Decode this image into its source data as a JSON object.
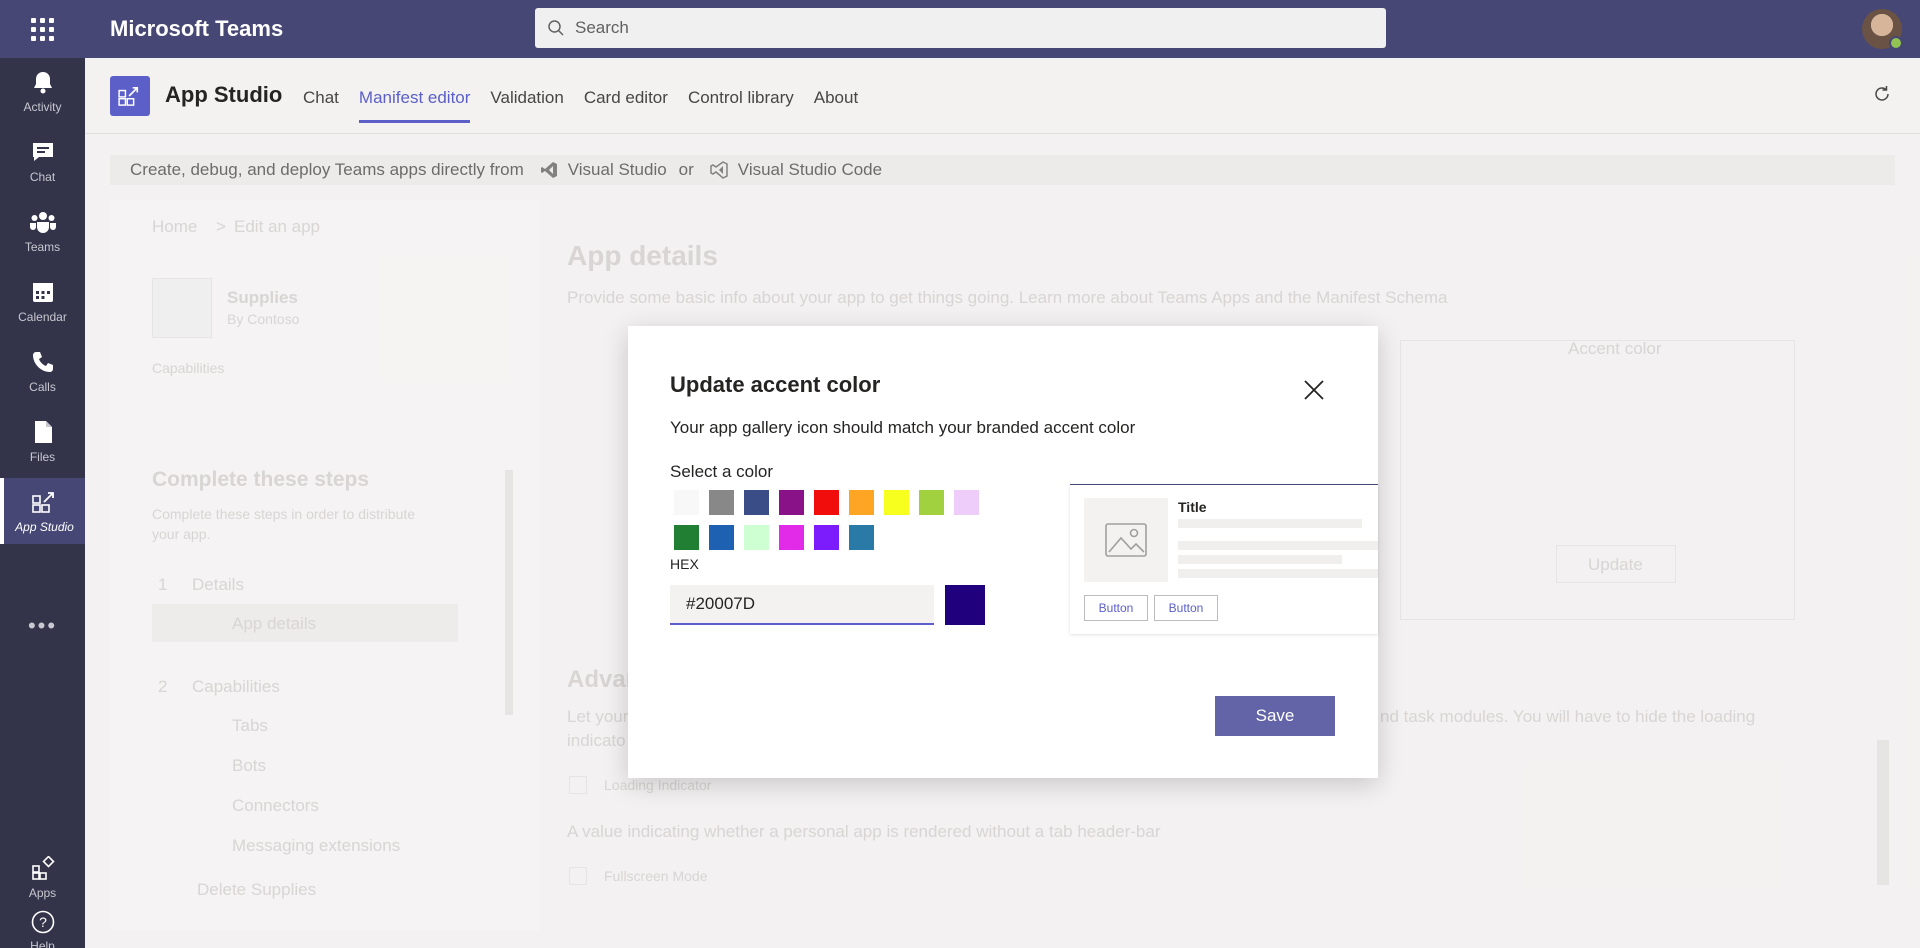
{
  "topbar": {
    "app_name": "Microsoft Teams",
    "search_placeholder": "Search"
  },
  "rail": {
    "items": [
      {
        "label": "Activity",
        "icon": "bell-icon"
      },
      {
        "label": "Chat",
        "icon": "chat-icon"
      },
      {
        "label": "Teams",
        "icon": "teams-icon"
      },
      {
        "label": "Calendar",
        "icon": "calendar-icon"
      },
      {
        "label": "Calls",
        "icon": "phone-icon"
      },
      {
        "label": "Files",
        "icon": "file-icon"
      },
      {
        "label": "App Studio",
        "icon": "app-studio-icon"
      }
    ],
    "more": "•••",
    "bottom": [
      {
        "label": "Apps",
        "icon": "apps-icon"
      },
      {
        "label": "Help",
        "icon": "help-icon"
      }
    ]
  },
  "app_header": {
    "title": "App Studio",
    "tabs": [
      "Chat",
      "Manifest editor",
      "Validation",
      "Card editor",
      "Control library",
      "About"
    ],
    "active_tab": "Manifest editor"
  },
  "banner": {
    "text": "Create, debug, and deploy Teams apps directly from",
    "vs": "Visual Studio",
    "or": "or",
    "vscode": "Visual Studio Code"
  },
  "background": {
    "breadcrumb_home": "Home",
    "breadcrumb_sep": ">",
    "breadcrumb_current": "Edit an app",
    "app_name": "Supplies",
    "app_by": "By Contoso",
    "capabilities": "Capabilities",
    "steps_title": "Complete these steps",
    "steps_desc_1": "Complete these steps in order to distribute",
    "steps_desc_2": "your app.",
    "step1_num": "1",
    "step1": "Details",
    "step1_sub": "App details",
    "step2_num": "2",
    "step2": "Capabilities",
    "step2_items": [
      "Tabs",
      "Bots",
      "Connectors",
      "Messaging extensions"
    ],
    "delete": "Delete Supplies",
    "main_title": "App details",
    "main_desc": "Provide some basic info about your app to get things going. Learn more about",
    "main_link1": "Teams Apps",
    "main_and": "and the",
    "main_link2": "Manifest Schema",
    "accent_color": "Accent color",
    "update": "Update",
    "adv_title": "Advan",
    "adv_desc_a": "Let your",
    "adv_desc_b": "nd task modules. You will have to hide the loading",
    "adv_desc_c": "indicato",
    "loading_indicator": "Loading Indicator",
    "fullscreen_desc": "A value indicating whether a personal app is rendered without a tab header-bar",
    "fullscreen": "Fullscreen Mode"
  },
  "dialog": {
    "title": "Update accent color",
    "subtitle": "Your app gallery icon should match your branded accent color",
    "select_label": "Select a color",
    "swatches": [
      "#f8f8f8",
      "#888888",
      "#3b4d86",
      "#8a1289",
      "#f20d0d",
      "#ffa524",
      "#f7ff1f",
      "#a2d140",
      "#efcdfa",
      "#207f32",
      "#1e61b2",
      "#cdffd3",
      "#e22be9",
      "#7c1cfc",
      "#2a7aa8"
    ],
    "hex_label": "HEX",
    "hex_value": "#20007D",
    "preview_color": "#20007D",
    "card": {
      "title": "Title",
      "button1": "Button",
      "button2": "Button"
    },
    "save": "Save"
  },
  "colors": {
    "teams_purple": "#464775",
    "rail_bg": "#33344a",
    "accent": "#6264a7"
  }
}
